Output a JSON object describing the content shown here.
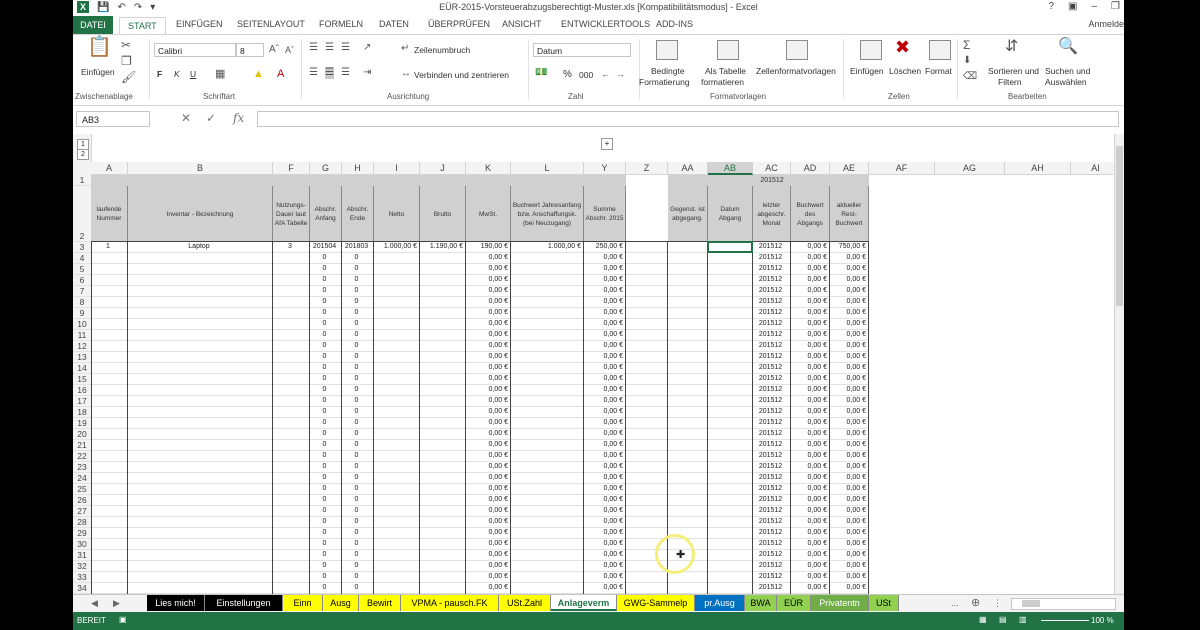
{
  "window": {
    "title": "EÜR-2015-Vorsteuerabzugsberechtigt-Muster.xls  [Kompatibilitätsmodus] - Excel",
    "user": "Anmelde",
    "logo": "X"
  },
  "ribbon_tabs": [
    "DATEI",
    "START",
    "EINFÜGEN",
    "SEITENLAYOUT",
    "FORMELN",
    "DATEN",
    "ÜBERPRÜFEN",
    "ANSICHT",
    "ENTWICKLERTOOLS",
    "ADD-INS"
  ],
  "ribbon": {
    "clipboard": {
      "paste": "Einfügen",
      "label": "Zwischenablage"
    },
    "font": {
      "name": "Calibri",
      "size": "8",
      "bold": "F",
      "italic": "K",
      "underline": "U",
      "label": "Schriftart"
    },
    "alignment": {
      "wrap": "Zeilenumbruch",
      "merge": "Verbinden und zentrieren",
      "label": "Ausrichtung"
    },
    "number": {
      "format": "Datum",
      "percent": "%",
      "thousands": "000",
      "label": "Zahl"
    },
    "styles": {
      "conditional": [
        "Bedingte",
        "Formatierung"
      ],
      "table": [
        "Als Tabelle",
        "formatieren"
      ],
      "cellstyles": "Zellenformatvorlagen",
      "label": "Formatvorlagen"
    },
    "cells": {
      "insert": "Einfügen",
      "delete": "Löschen",
      "format": "Format",
      "label": "Zellen"
    },
    "editing": {
      "sort": [
        "Sortieren und",
        "Filtern"
      ],
      "find": [
        "Suchen und",
        "Auswählen"
      ],
      "label": "Bearbeiten"
    }
  },
  "formula_bar": {
    "name_box": "AB3",
    "fx": "fx",
    "content": ""
  },
  "outline": {
    "levels": [
      "1",
      "2"
    ],
    "group_toggle": "+"
  },
  "columns": [
    "A",
    "B",
    "F",
    "G",
    "H",
    "I",
    "J",
    "K",
    "L",
    "Y",
    "Z",
    "AA",
    "AB",
    "AC",
    "AD",
    "AE",
    "AF",
    "AG",
    "AH",
    "AI"
  ],
  "header_row": {
    "A": "laufende Nummer",
    "B": "Inventar - Bezeichnung",
    "F": "Nutzungs-Dauer laut AfA Tabelle",
    "G": "Abschr. Anfang",
    "H": "Abschr. Ende",
    "I": "Netto",
    "J": "Brutto",
    "K": "MwSt.",
    "L": "Buchwert Jahresanfang bzw. Anschaffungsk. (bei Neuzugang)",
    "Y": "Summe Abschr. 2015",
    "AA": "Gegenst. ist abgegang.",
    "AB": "Datum Abgang",
    "AC": "letzter abgeschr. Monat",
    "AD": "Buchwert des Abgangs",
    "AE": "aktueller Rest-Buchwert",
    "AC_top": "201512"
  },
  "row3": {
    "A": "1",
    "B": "Laptop",
    "F": "3",
    "G": "201504",
    "H": "201803",
    "I": "1.000,00 €",
    "J": "1.190,00 €",
    "K": "190,00 €",
    "L": "1.000,00 €",
    "Y": "250,00 €",
    "AC": "201512",
    "AD": "0,00 €",
    "AE": "750,00 €"
  },
  "repeat_rows": {
    "G": "0",
    "H": "0",
    "K": "0,00 €",
    "Y": "0,00 €",
    "AC": "201512",
    "AD": "0,00 €",
    "AE": "0,00 €"
  },
  "row_numbers": [
    "1",
    "2",
    "3",
    "4",
    "5",
    "6",
    "7",
    "8",
    "9",
    "10",
    "11",
    "12",
    "13",
    "14",
    "15",
    "16",
    "17",
    "18",
    "19",
    "20",
    "21",
    "22",
    "23",
    "24",
    "25",
    "26",
    "27",
    "28",
    "29",
    "30",
    "31",
    "32",
    "33",
    "34"
  ],
  "sheet_tabs": [
    {
      "label": "Lies mich!",
      "bg": "#000000",
      "fg": "#ffffff"
    },
    {
      "label": "Einstellungen",
      "bg": "#000000",
      "fg": "#ffffff"
    },
    {
      "label": "Einn",
      "bg": "#ffff00",
      "fg": "#000000"
    },
    {
      "label": "Ausg",
      "bg": "#ffff00",
      "fg": "#000000"
    },
    {
      "label": "Bewirt",
      "bg": "#ffff00",
      "fg": "#000000"
    },
    {
      "label": "VPMA - pausch.FK",
      "bg": "#ffff00",
      "fg": "#000000"
    },
    {
      "label": "USt.Zahl",
      "bg": "#ffff00",
      "fg": "#000000"
    },
    {
      "label": "Anlageverm",
      "bg": "#ffffff",
      "fg": "#217346"
    },
    {
      "label": "GWG-Sammelp",
      "bg": "#ffff00",
      "fg": "#000000"
    },
    {
      "label": "pr.Ausg",
      "bg": "#0070c0",
      "fg": "#ffffff"
    },
    {
      "label": "BWA",
      "bg": "#92d050",
      "fg": "#000000"
    },
    {
      "label": "EÜR",
      "bg": "#92d050",
      "fg": "#000000"
    },
    {
      "label": "Privatentn",
      "bg": "#70ad47",
      "fg": "#ffffff"
    },
    {
      "label": "USt",
      "bg": "#92d050",
      "fg": "#000000"
    }
  ],
  "sheet_more": "...",
  "status": {
    "mode": "BEREIT",
    "zoom": "100 %"
  }
}
